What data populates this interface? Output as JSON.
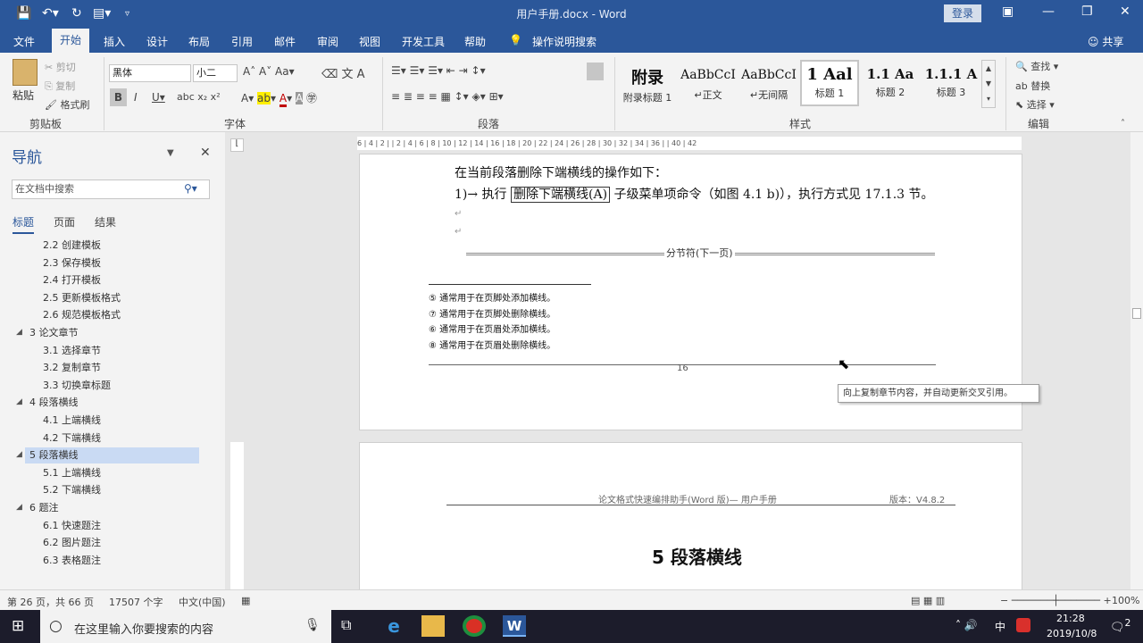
{
  "titlebar": {
    "doc_title": "用户手册.docx  -  Word",
    "login": "登录"
  },
  "tabs": [
    "文件",
    "开始",
    "插入",
    "设计",
    "布局",
    "引用",
    "邮件",
    "审阅",
    "视图",
    "开发工具",
    "帮助"
  ],
  "tell_me": "操作说明搜索",
  "share": "共享",
  "ribbon": {
    "clipboard": {
      "paste": "粘贴",
      "cut": "剪切",
      "copy": "复制",
      "format_painter": "格式刷",
      "label": "剪贴板"
    },
    "font": {
      "name": "黑体",
      "size": "小二",
      "label": "字体"
    },
    "paragraph": {
      "label": "段落"
    },
    "styles": {
      "label": "样式",
      "items": [
        {
          "preview": "附录",
          "name": "附录标题 1"
        },
        {
          "preview": "AaBbCcI",
          "name": "↵正文"
        },
        {
          "preview": "AaBbCcI",
          "name": "↵无间隔"
        },
        {
          "preview": "1  Aal",
          "name": "标题 1"
        },
        {
          "preview": "1.1  Aa",
          "name": "标题 2"
        },
        {
          "preview": "1.1.1  A",
          "name": "标题 3"
        }
      ]
    },
    "editing": {
      "find": "查找",
      "replace": "替换",
      "select": "选择",
      "label": "编辑"
    }
  },
  "nav": {
    "title": "导航",
    "search_placeholder": "在文档中搜索",
    "tabs": [
      "标题",
      "页面",
      "结果"
    ],
    "items": [
      {
        "text": "2.2 创建模板",
        "level": 2
      },
      {
        "text": "2.3 保存模板",
        "level": 2
      },
      {
        "text": "2.4 打开模板",
        "level": 2
      },
      {
        "text": "2.5 更新模板格式",
        "level": 2
      },
      {
        "text": "2.6 规范模板格式",
        "level": 2
      },
      {
        "text": "3 论文章节",
        "level": 1
      },
      {
        "text": "3.1 选择章节",
        "level": 2
      },
      {
        "text": "3.2 复制章节",
        "level": 2
      },
      {
        "text": "3.3 切换章标题",
        "level": 2
      },
      {
        "text": "4 段落横线",
        "level": 1
      },
      {
        "text": "4.1 上端横线",
        "level": 2
      },
      {
        "text": "4.2 下端横线",
        "level": 2
      },
      {
        "text": "5 段落横线",
        "level": 1,
        "active": true
      },
      {
        "text": "5.1 上端横线",
        "level": 2
      },
      {
        "text": "5.2 下端横线",
        "level": 2
      },
      {
        "text": "6 题注",
        "level": 1
      },
      {
        "text": "6.1 快速题注",
        "level": 2
      },
      {
        "text": "6.2 图片题注",
        "level": 2
      },
      {
        "text": "6.3 表格题注",
        "level": 2
      }
    ]
  },
  "ruler": "6 | 4 | 2 |   | 2 | 4 | 6 | 8 | 10 | 12 | 14 | 16 | 18 | 20 | 22 | 24 | 26 | 28 | 30 | 32 | 34 | 36 |   | 40 | 42",
  "page1": {
    "line1": "在当前段落删除下端横线的操作如下：",
    "line2_prefix": "1)→ 执行 ",
    "line2_box": "删除下端横线(A)",
    "line2_suffix": " 子级菜单项命令（如图 4.1 b)），执行方式见 17.1.3 节。",
    "section_break": "分节符(下一页)",
    "footnotes": [
      "⑤ 通常用于在页脚处添加横线。",
      "⑦ 通常用于在页脚处删除横线。",
      "⑥ 通常用于在页眉处添加横线。",
      "⑧ 通常用于在页眉处删除横线。"
    ],
    "page_number": "16"
  },
  "page2": {
    "header_center": "论文格式快速编排助手(Word 版)— 用户手册",
    "header_right": "版本：V4.8.2",
    "chapter_title": "5 段落横线"
  },
  "tooltip": "向上复制章节内容，并自动更新交叉引用。",
  "status": {
    "page": "第 26 页，共 66 页",
    "words": "17507 个字",
    "lang": "中文(中国)",
    "zoom": "100%"
  },
  "taskbar": {
    "search_placeholder": "在这里输入你要搜索的内容",
    "ime": "中",
    "time": "21:28",
    "date": "2019/10/8",
    "notifications": "2"
  }
}
